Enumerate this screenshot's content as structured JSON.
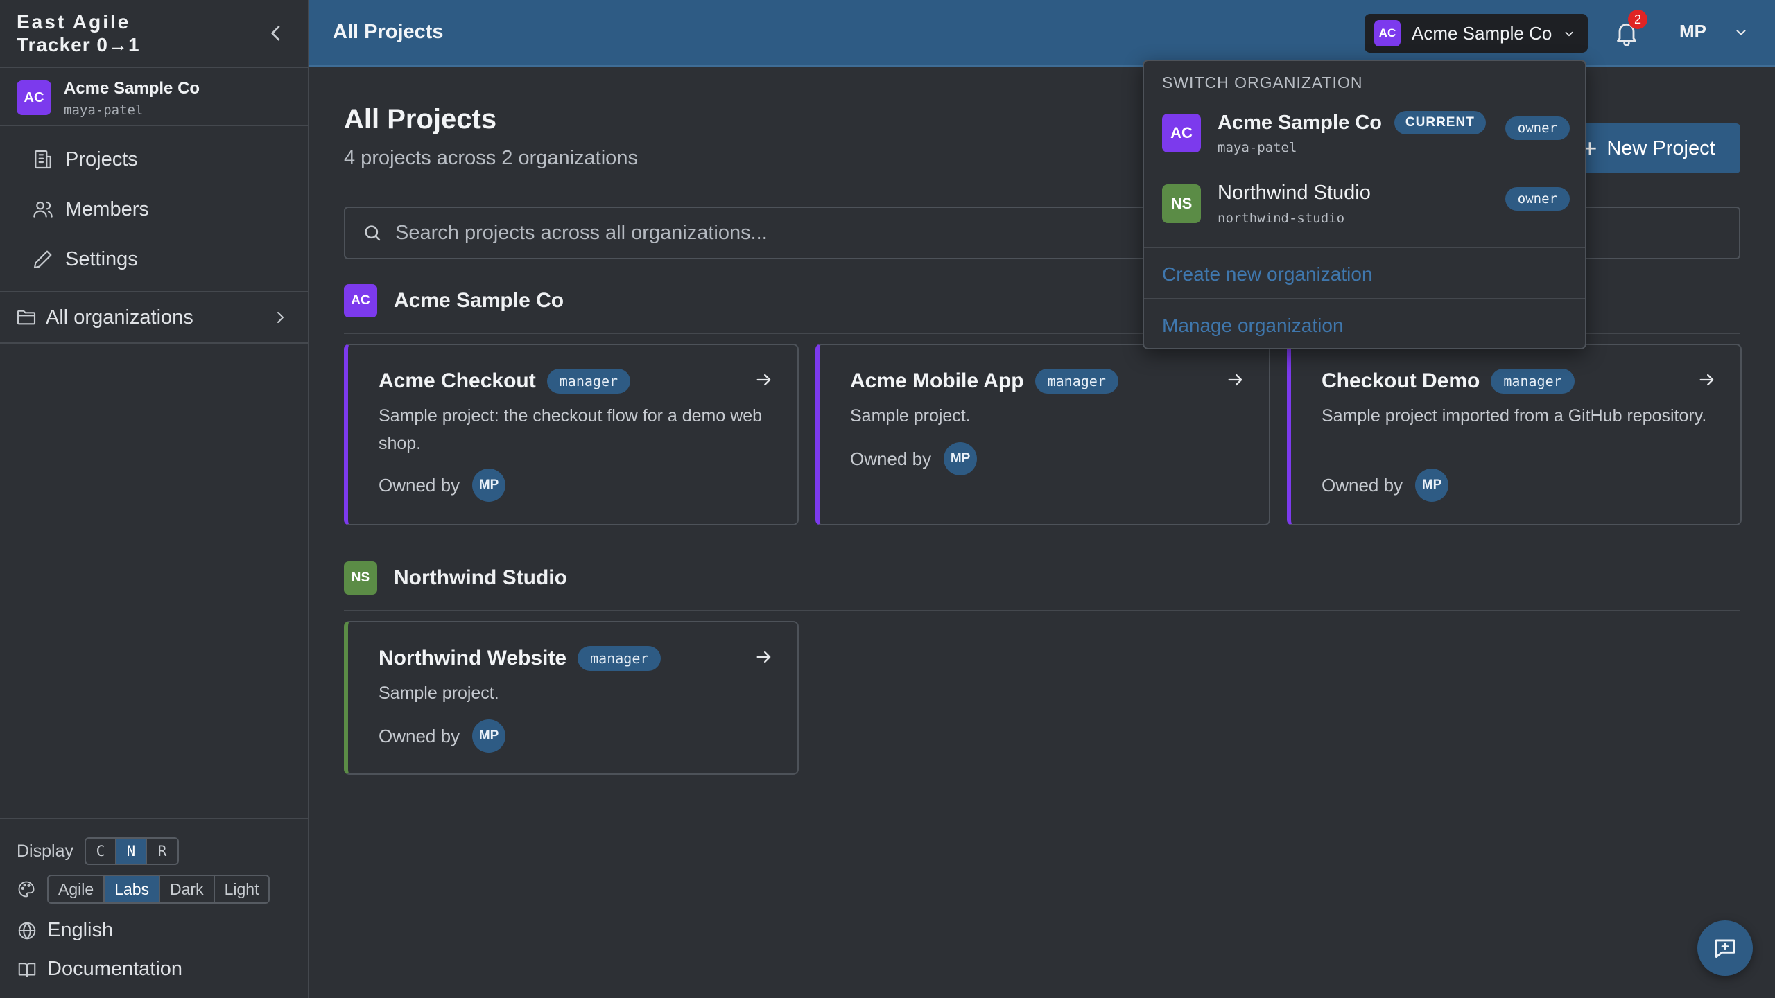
{
  "brand": {
    "line1": "East Agile",
    "line2": "Tracker 0→1"
  },
  "sidebar": {
    "org": {
      "avatar": "AC",
      "name": "Acme Sample Co",
      "slug": "maya-patel"
    },
    "nav": [
      {
        "label": "Projects",
        "icon": "building-icon"
      },
      {
        "label": "Members",
        "icon": "users-icon"
      },
      {
        "label": "Settings",
        "icon": "pencil-icon"
      }
    ],
    "all_orgs": "All organizations",
    "display_label": "Display",
    "display_options": [
      "C",
      "N",
      "R"
    ],
    "display_active": "N",
    "themes": [
      "Agile",
      "Labs",
      "Dark",
      "Light"
    ],
    "theme_active": "Labs",
    "language": "English",
    "docs": "Documentation"
  },
  "header": {
    "title": "All Projects",
    "org_switch": {
      "avatar": "AC",
      "label": "Acme Sample Co"
    },
    "notifications": "2",
    "user": "MP"
  },
  "main": {
    "title": "All Projects",
    "subtitle": "4 projects across 2 organizations",
    "new_project": "New Project",
    "search_placeholder": "Search projects across all organizations...",
    "sections": [
      {
        "avatar": "AC",
        "name": "Acme Sample Co",
        "projects": [
          {
            "name": "Acme Checkout",
            "role": "manager",
            "desc": "Sample project: the checkout flow for a demo web shop.",
            "owned_by": "Owned by",
            "owner": "MP"
          },
          {
            "name": "Acme Mobile App",
            "role": "manager",
            "desc": "Sample project.",
            "owned_by": "Owned by",
            "owner": "MP"
          },
          {
            "name": "Checkout Demo",
            "role": "manager",
            "desc": "Sample project imported from a GitHub repository.",
            "owned_by": "Owned by",
            "owner": "MP"
          }
        ]
      },
      {
        "avatar": "NS",
        "name": "Northwind Studio",
        "projects": [
          {
            "name": "Northwind Website",
            "role": "manager",
            "desc": "Sample project.",
            "owned_by": "Owned by",
            "owner": "MP"
          }
        ]
      }
    ]
  },
  "dropdown": {
    "heading": "SWITCH ORGANIZATION",
    "orgs": [
      {
        "avatar": "AC",
        "name": "Acme Sample Co",
        "current": "CURRENT",
        "role": "owner",
        "slug": "maya-patel"
      },
      {
        "avatar": "NS",
        "name": "Northwind Studio",
        "role": "owner",
        "slug": "northwind-studio"
      }
    ],
    "create": "Create new organization",
    "manage": "Manage organization"
  },
  "colors": {
    "header": "#2e5b84",
    "accent_purple": "#7c3aed",
    "accent_green": "#5b8c46",
    "badge": "#e02424",
    "link": "#3f77ad"
  }
}
